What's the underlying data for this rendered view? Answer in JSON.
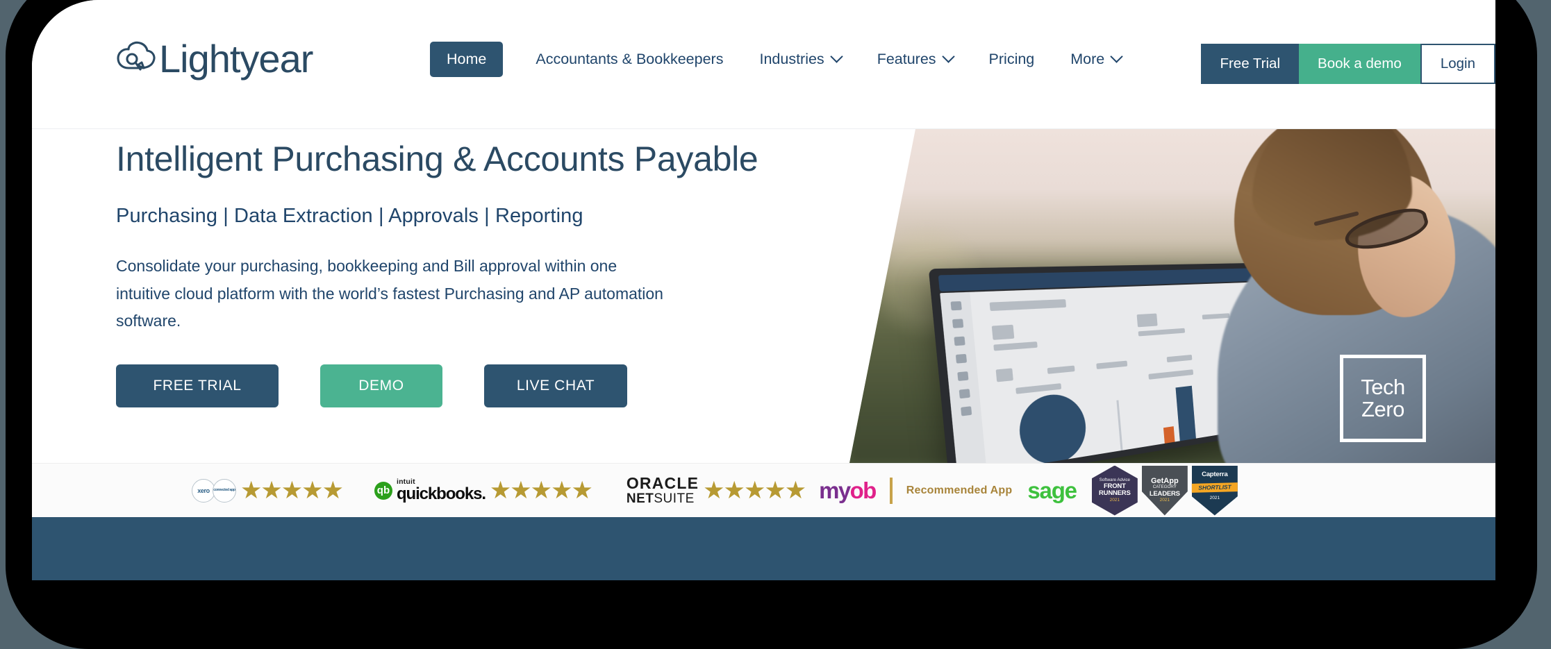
{
  "brand": {
    "logo_word": "Lightyear",
    "logo_icon": "cloud-search-icon",
    "color_navy": "#2e5470",
    "color_green": "#45b08c",
    "color_text_navy": "#20456b",
    "color_star_gold": "#b79a33"
  },
  "nav": {
    "home_label": "Home",
    "items": [
      {
        "label": "Accountants & Bookkeepers",
        "has_dropdown": false
      },
      {
        "label": "Industries",
        "has_dropdown": true
      },
      {
        "label": "Features",
        "has_dropdown": true
      },
      {
        "label": "Pricing",
        "has_dropdown": false
      },
      {
        "label": "More",
        "has_dropdown": true
      }
    ],
    "actions": [
      {
        "label": "Free Trial",
        "style": "navy"
      },
      {
        "label": "Book a demo",
        "style": "green"
      },
      {
        "label": "Login",
        "style": "outline"
      }
    ]
  },
  "hero": {
    "title": "Intelligent Purchasing & Accounts Payable",
    "subtitle": "Purchasing  | Data Extraction  | Approvals  |  Reporting",
    "description": "Consolidate your purchasing, bookkeeping and Bill approval within one intuitive cloud platform with the world’s fastest Purchasing and AP automation software.",
    "buttons": [
      {
        "label": "FREE TRIAL",
        "style": "navy"
      },
      {
        "label": "DEMO",
        "style": "green"
      },
      {
        "label": "LIVE CHAT",
        "style": "navy"
      }
    ],
    "image_alt": "woman-with-laptop-outdoors-photo",
    "overlay_badge": {
      "line1": "Tech",
      "line2": "Zero"
    }
  },
  "logo_strip": {
    "items": [
      {
        "name": "xero",
        "label": "xero",
        "sublabel": "connected app",
        "stars": 5
      },
      {
        "name": "quickbooks",
        "intuit": "intuit",
        "label": "quickbooks.",
        "stars": 5
      },
      {
        "name": "oracle-netsuite",
        "line1": "ORACLE",
        "line2a": "NET",
        "line2b": "SUITE",
        "stars": 5
      },
      {
        "name": "myob",
        "label_a": "my",
        "label_b": "ob",
        "note": "Recommended App"
      },
      {
        "name": "sage",
        "label": "sage"
      }
    ],
    "badges": [
      {
        "name": "software-advice-front-runners",
        "top": "Software Advice",
        "main": "FRONT RUNNERS",
        "year": "2021"
      },
      {
        "name": "getapp-category-leaders",
        "top": "GetApp",
        "sub": "CATEGORY",
        "main": "LEADERS",
        "year": "2021"
      },
      {
        "name": "capterra-shortlist",
        "top": "Capterra",
        "main": "SHORTLIST",
        "year": "2021"
      }
    ],
    "star_glyph": "★"
  }
}
